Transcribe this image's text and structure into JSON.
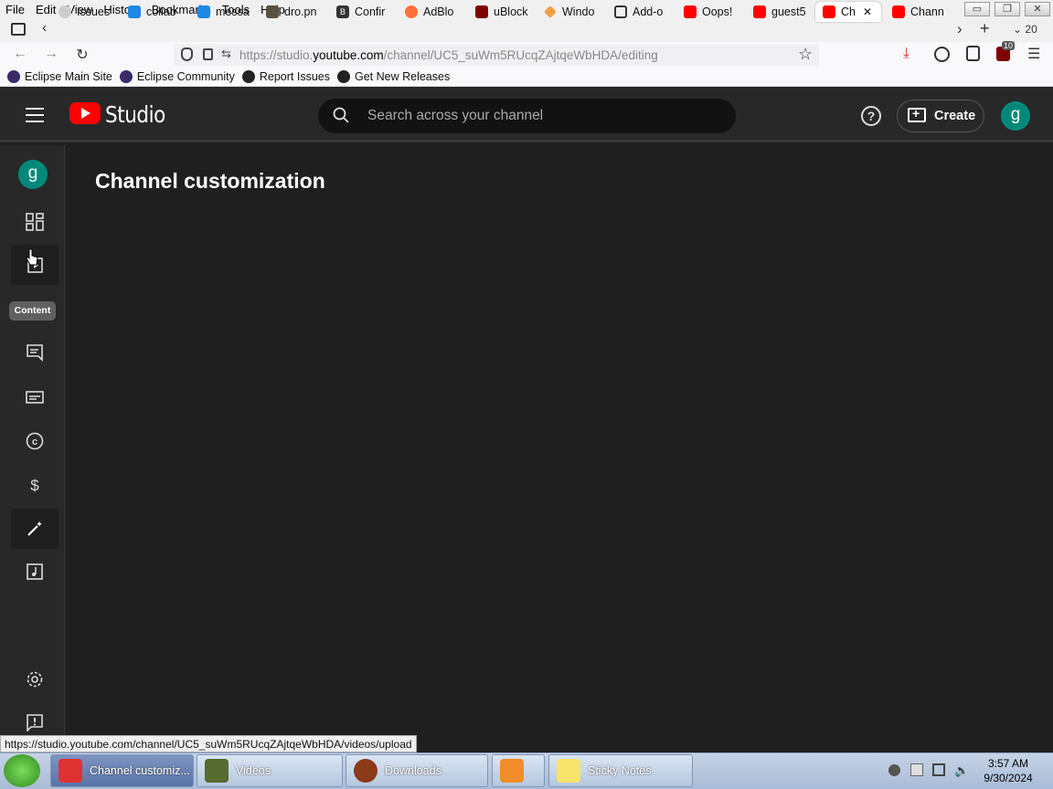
{
  "menubar": {
    "items": [
      "File",
      "Edit",
      "View",
      "History",
      "Bookmarks",
      "Tools",
      "Help"
    ]
  },
  "tabs": [
    {
      "label": "Issues",
      "icon": "github-icon"
    },
    {
      "label": "collab",
      "icon": "doc-icon"
    },
    {
      "label": "messa",
      "icon": "doc-icon"
    },
    {
      "label": "dro.pn",
      "icon": "image-icon"
    },
    {
      "label": "Confir",
      "icon": "b-icon"
    },
    {
      "label": "AdBlo",
      "icon": "firefox-icon"
    },
    {
      "label": "uBlock",
      "icon": "ublock-icon"
    },
    {
      "label": "Windo",
      "icon": "diamond-icon"
    },
    {
      "label": "Add-o",
      "icon": "puzzle-icon"
    },
    {
      "label": "Oops!",
      "icon": "youtube-icon"
    },
    {
      "label": "guest5",
      "icon": "youtube-icon"
    },
    {
      "label": "Ch",
      "icon": "youtube-studio-icon",
      "active": true
    },
    {
      "label": "Chann",
      "icon": "youtube-icon"
    }
  ],
  "tab_overflow_count": "20",
  "url": {
    "prefix": "https://studio.",
    "domain": "youtube.com",
    "path": "/channel/UC5_suWm5RUcqZAjtqeWbHDA/editing"
  },
  "extension_badge": "10",
  "bookmarks": [
    {
      "label": "Eclipse Main Site",
      "icon": "eclipse-icon"
    },
    {
      "label": "Eclipse Community",
      "icon": "eclipse-icon"
    },
    {
      "label": "Report Issues",
      "icon": "github-icon"
    },
    {
      "label": "Get New Releases",
      "icon": "github-icon"
    }
  ],
  "studio": {
    "logo_text": "Studio",
    "search_placeholder": "Search across your channel",
    "create_label": "Create",
    "avatar_letter": "g",
    "page_title": "Channel customization",
    "tooltip": "Content"
  },
  "status_url": "https://studio.youtube.com/channel/UC5_suWm5RUcqZAjtqeWbHDA/videos/upload",
  "taskbar": {
    "buttons": [
      {
        "label": "Channel customiz...",
        "active": true
      },
      {
        "label": "Videos"
      },
      {
        "label": "Downloads"
      },
      {
        "label": ""
      },
      {
        "label": "Sticky Notes"
      }
    ],
    "time": "3:57 AM",
    "date": "9/30/2024"
  },
  "colors": {
    "header_bg": "#282828",
    "page_bg": "#1f1f1f",
    "youtube_red": "#ff0000",
    "avatar": "#00897b"
  }
}
